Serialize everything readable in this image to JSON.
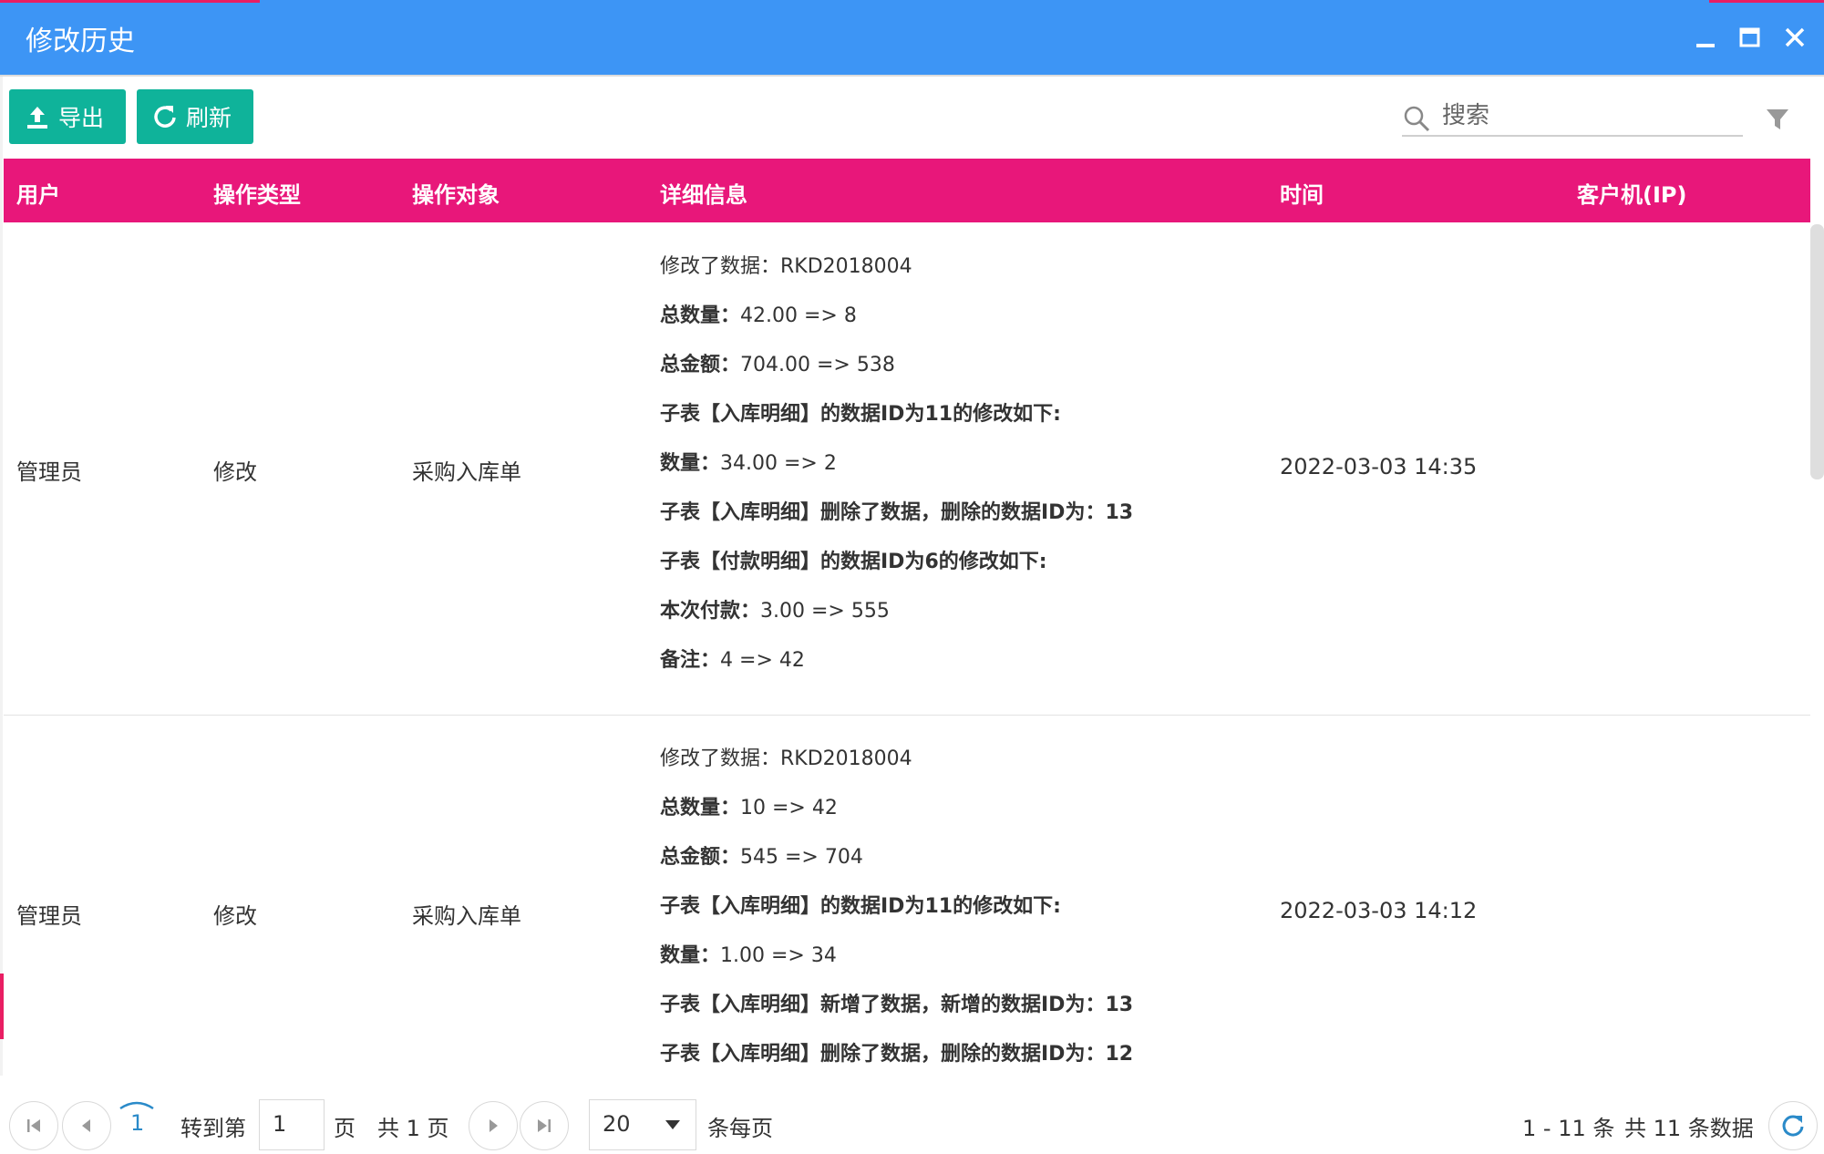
{
  "window": {
    "title": "修改历史",
    "accent_color": "#3d95f5",
    "controls": [
      "minimize-icon",
      "maximize-icon",
      "close-icon"
    ]
  },
  "toolbar": {
    "export_label": "导出",
    "refresh_label": "刷新",
    "button_color": "#0fb39a",
    "search": {
      "placeholder": "搜索",
      "value": ""
    }
  },
  "table": {
    "header_color": "#e8177a",
    "columns": [
      "用户",
      "操作类型",
      "操作对象",
      "详细信息",
      "时间",
      "客户机(IP)"
    ],
    "rows": [
      {
        "user": "管理员",
        "op_type": "修改",
        "target": "采购入库单",
        "time": "2022-03-03 14:35",
        "ip": "",
        "details": [
          {
            "label": "",
            "text": "修改了数据：RKD2018004"
          },
          {
            "label": "总数量：",
            "text": "42.00   =>   8"
          },
          {
            "label": "总金额：",
            "text": "704.00   =>   538"
          },
          {
            "label": "子表【入库明细】的数据ID为11的修改如下:",
            "text": ""
          },
          {
            "label": "数量：",
            "text": "34.00   =>   2"
          },
          {
            "label": "子表【入库明细】删除了数据，删除的数据ID为：13",
            "text": ""
          },
          {
            "label": "子表【付款明细】的数据ID为6的修改如下:",
            "text": ""
          },
          {
            "label": "本次付款：",
            "text": "3.00   =>   555"
          },
          {
            "label": "备注：",
            "text": "4   =>   42"
          }
        ]
      },
      {
        "user": "管理员",
        "op_type": "修改",
        "target": "采购入库单",
        "time": "2022-03-03 14:12",
        "ip": "",
        "details": [
          {
            "label": "",
            "text": "修改了数据：RKD2018004"
          },
          {
            "label": "总数量：",
            "text": "10   =>   42"
          },
          {
            "label": "总金额：",
            "text": "545   =>   704"
          },
          {
            "label": "子表【入库明细】的数据ID为11的修改如下:",
            "text": ""
          },
          {
            "label": "数量：",
            "text": "1.00   =>   34"
          },
          {
            "label": "子表【入库明细】新增了数据，新增的数据ID为：13",
            "text": ""
          },
          {
            "label": "子表【入库明细】删除了数据，删除的数据ID为：12",
            "text": ""
          }
        ]
      }
    ]
  },
  "pager": {
    "current_page": "1",
    "goto_label": "转到第",
    "goto_value": "1",
    "page_label": "页",
    "total_pages_text": "共 1 页",
    "page_size": "20",
    "per_page_label": "条每页",
    "range_text": "1 - 11 条",
    "total_text": "共 11 条数据"
  }
}
